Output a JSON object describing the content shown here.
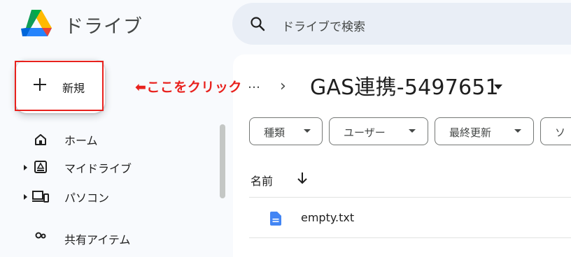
{
  "header": {
    "app_title": "ドライブ",
    "search_placeholder": "ドライブで検索"
  },
  "new_button": {
    "label": "新規"
  },
  "annotation": {
    "text": "⬅ここをクリック",
    "color": "#e8211d"
  },
  "breadcrumb": {
    "ellipsis": "…",
    "separator": "›",
    "current_folder": "GAS連携-5497651"
  },
  "filters": {
    "chips": [
      "種類",
      "ユーザー",
      "最終更新",
      "ソ"
    ]
  },
  "sidebar": {
    "items": [
      {
        "label": "ホーム",
        "icon": "home-icon"
      },
      {
        "label": "マイドライブ",
        "icon": "my-drive-icon"
      },
      {
        "label": "パソコン",
        "icon": "computer-icon"
      },
      {
        "label": "共有アイテム",
        "icon": "shared-icon"
      }
    ]
  },
  "file_list": {
    "column_name": "名前",
    "sort": "descending",
    "rows": [
      {
        "name": "empty.txt",
        "icon": "doc-icon",
        "icon_color": "#4285f4"
      }
    ]
  },
  "colors": {
    "background": "#f8fafd",
    "search_bg": "#e9eef6",
    "accent_red": "#e8211d"
  }
}
